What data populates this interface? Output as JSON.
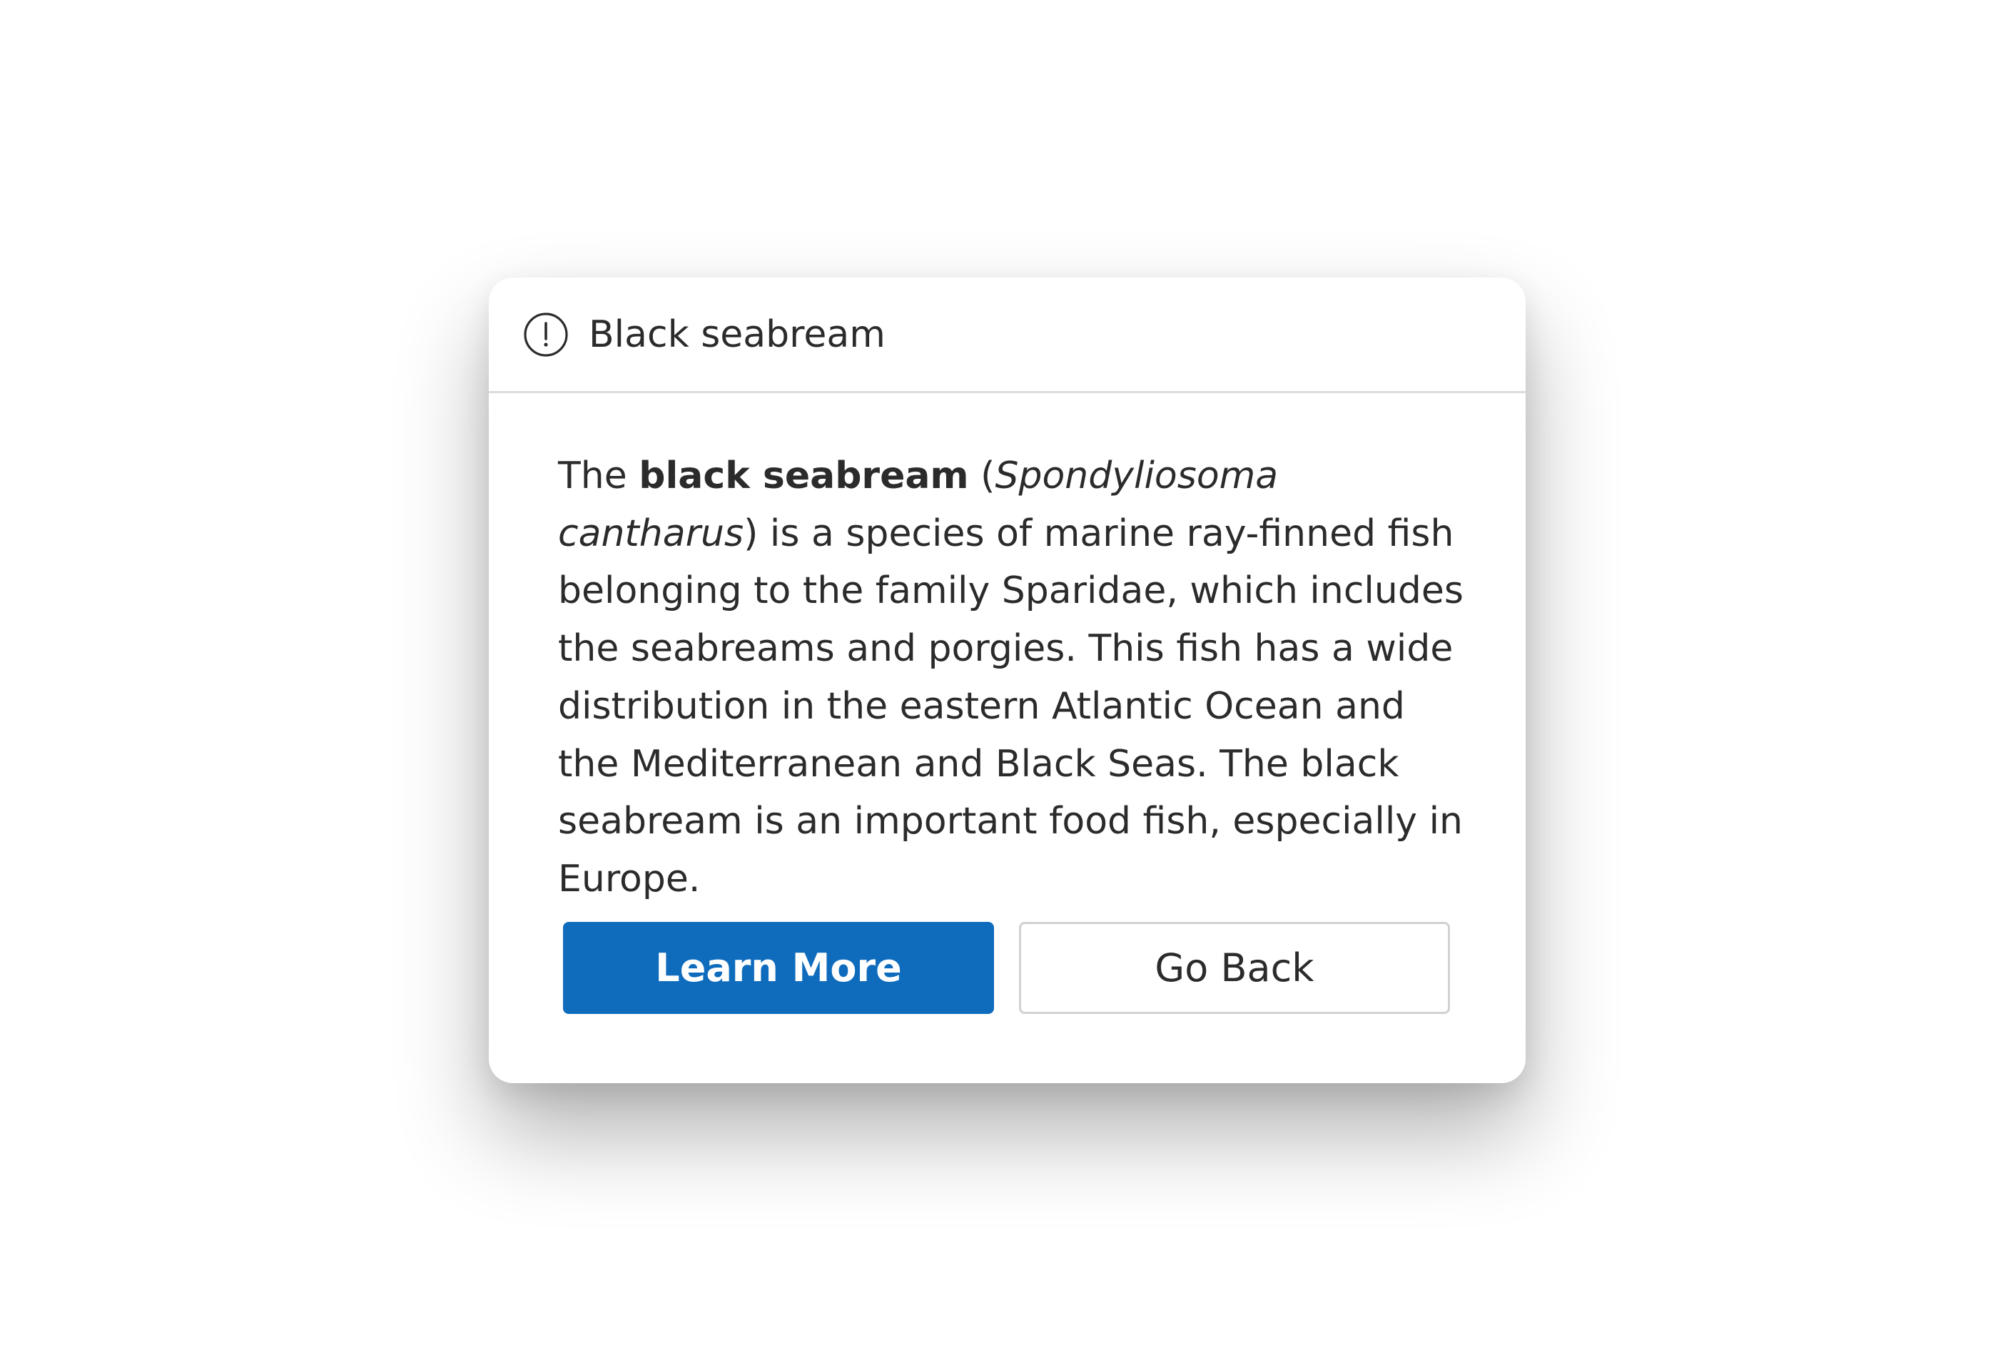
{
  "dialog": {
    "title": "Black seabream",
    "icon": "info-circle-icon",
    "body": {
      "lead": "The ",
      "term": "black seabream",
      "open_paren": " (",
      "scientific_name": "Spondyliosoma cantharus",
      "rest": ") is a species of marine ray-finned fish belonging to the family Sparidae, which includes the seabreams and porgies. This fish has a wide distribution in the eastern Atlantic Ocean and the Mediterranean and Black Seas. The black seabream is an important food fish, especially in Europe."
    },
    "buttons": {
      "primary_label": "Learn More",
      "secondary_label": "Go Back"
    }
  },
  "colors": {
    "primary_button": "#0f6cbd",
    "text": "#2b2b2b",
    "divider": "#dcdcdc"
  }
}
